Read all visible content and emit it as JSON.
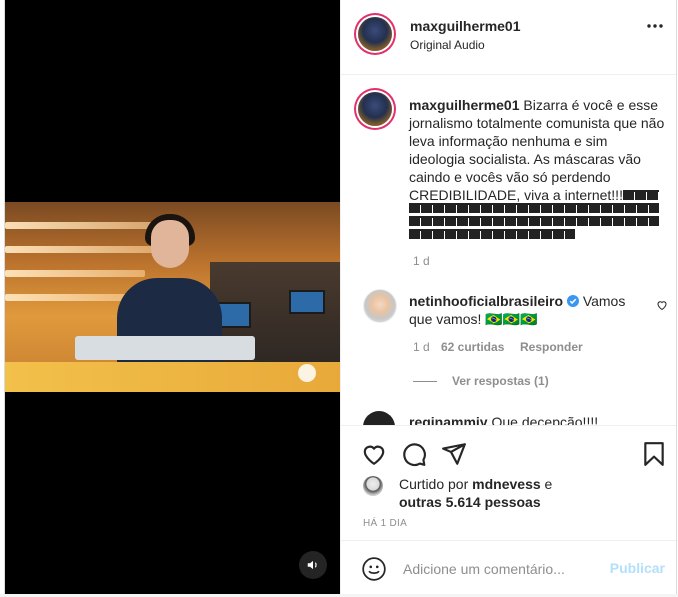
{
  "post": {
    "username": "maxguilherme01",
    "audio": "Original Audio"
  },
  "caption": {
    "username": "maxguilherme01",
    "text": "Bizarra é você e esse jornalismo totalmente comunista que não leva informação nenhuma e sim ideologia socialista. As máscaras vão caindo e vocês vão só perdendo CREDIBILIDADE, viva a internet!!!",
    "time": "1 d"
  },
  "comments": [
    {
      "username": "netinhooficialbrasileiro",
      "verified": true,
      "text": "Vamos que vamos!",
      "emoji": "🇧🇷🇧🇷🇧🇷",
      "time": "1 d",
      "likes": "62 curtidas",
      "reply": "Responder",
      "view_replies": "Ver respostas (1)"
    },
    {
      "username": "reginammiy",
      "text": "Que decepção!!!!"
    }
  ],
  "likes": {
    "prefix": "Curtido por",
    "user": "mdnevess",
    "connector": "e",
    "others": "outras 5.614 pessoas"
  },
  "time_ago": "HÁ 1 DIA",
  "composer": {
    "placeholder": "Adicione um comentário...",
    "publish": "Publicar"
  },
  "colors": {
    "verified": "#3897f0",
    "publish_disabled": "#b2dffc",
    "meta": "#8e8e8e"
  },
  "icons": [
    "more-icon",
    "heart-icon",
    "comment-icon",
    "share-icon",
    "bookmark-icon",
    "emoji-icon",
    "volume-icon",
    "verified-icon"
  ]
}
